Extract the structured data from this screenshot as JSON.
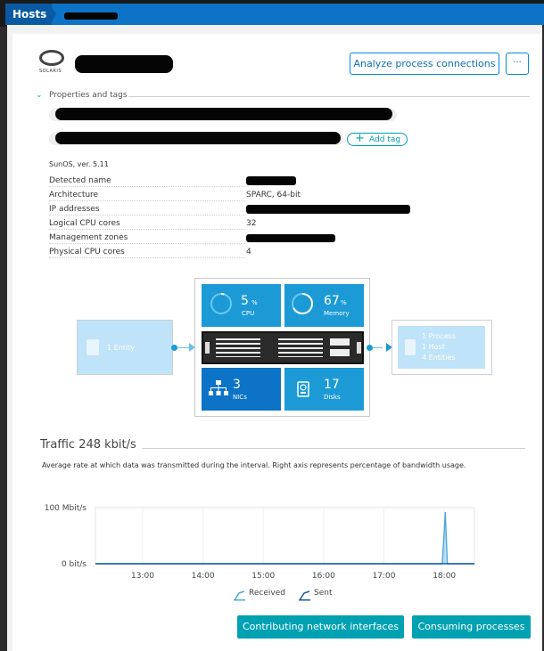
{
  "breadcrumb": {
    "root": "Hosts"
  },
  "header": {
    "os_logo_text": "SOLARIS",
    "analyze_button": "Analyze process connections",
    "more_button": "···"
  },
  "properties": {
    "section_title": "Properties and tags",
    "add_tag": "Add tag",
    "os_version": "SunOS, ver. 5.11",
    "rows": [
      {
        "label": "Detected name",
        "value": ""
      },
      {
        "label": "Architecture",
        "value": "SPARC, 64-bit"
      },
      {
        "label": "IP addresses",
        "value": ""
      },
      {
        "label": "Logical CPU cores",
        "value": "32"
      },
      {
        "label": "Management zones",
        "value": ""
      },
      {
        "label": "Physical CPU cores",
        "value": "4"
      }
    ]
  },
  "infra": {
    "left_entity": "1 Entity",
    "cpu_value": "5",
    "cpu_unit": "%",
    "cpu_label": "CPU",
    "cpu_percent": 5,
    "mem_value": "67",
    "mem_unit": "%",
    "mem_label": "Memory",
    "mem_percent": 67,
    "nics_value": "3",
    "nics_label": "NICs",
    "disks_value": "17",
    "disks_label": "Disks",
    "right_lines": [
      "1 Process",
      "1 Host",
      "4 Entities"
    ]
  },
  "traffic": {
    "title": "Traffic 248 kbit/s",
    "description": "Average rate at which data was transmitted during the interval. Right axis represents percentage of bandwidth usage.",
    "legend_received": "Received",
    "legend_sent": "Sent",
    "colors": {
      "received": "#4fa8dc",
      "sent": "#1a5d9c"
    }
  },
  "chart_data": {
    "type": "area",
    "yticks": [
      "100 Mbit/s",
      "0 bit/s"
    ],
    "ylim": [
      0,
      100
    ],
    "xticks": [
      "13:00",
      "14:00",
      "15:00",
      "16:00",
      "17:00",
      "18:00"
    ],
    "xlim": [
      "12:13",
      "18:30"
    ],
    "series": [
      {
        "name": "Received",
        "points": [
          [
            "12:13",
            0
          ],
          [
            "17:58",
            0
          ],
          [
            "18:00",
            60
          ],
          [
            "18:01",
            92
          ],
          [
            "18:03",
            0
          ],
          [
            "18:30",
            0
          ]
        ]
      },
      {
        "name": "Sent",
        "points": [
          [
            "12:13",
            0
          ],
          [
            "18:30",
            0
          ]
        ]
      }
    ]
  },
  "footer": {
    "contributing_button": "Contributing network interfaces",
    "consuming_button": "Consuming processes"
  }
}
